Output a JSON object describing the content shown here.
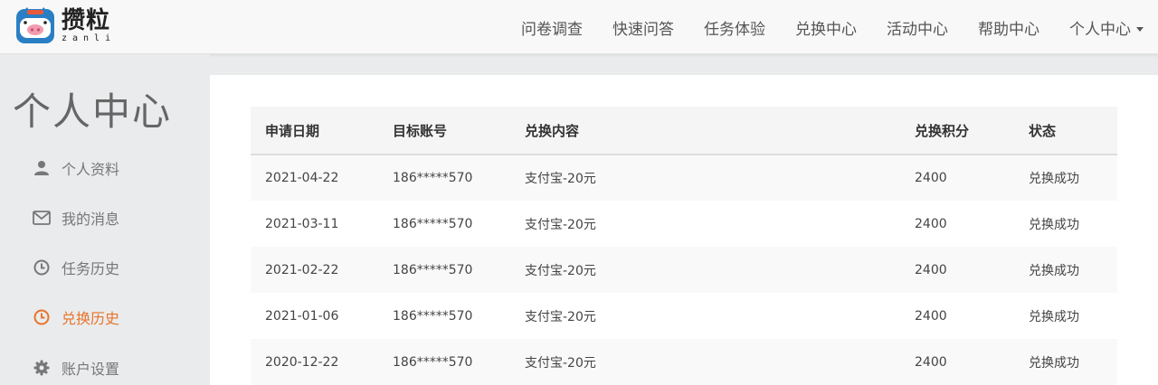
{
  "brand": {
    "name_cn": "攒粒",
    "name_en": "zanli"
  },
  "nav": {
    "items": [
      "问卷调查",
      "快速问答",
      "任务体验",
      "兑换中心",
      "活动中心",
      "帮助中心"
    ],
    "account": "个人中心"
  },
  "sidebar": {
    "title": "个人中心",
    "items": [
      {
        "label": "个人资料",
        "icon": "user-icon"
      },
      {
        "label": "我的消息",
        "icon": "envelope-icon"
      },
      {
        "label": "任务历史",
        "icon": "clock-icon"
      },
      {
        "label": "兑换历史",
        "icon": "clock-icon",
        "active": true
      },
      {
        "label": "账户设置",
        "icon": "gear-icon"
      }
    ]
  },
  "colors": {
    "accent": "#e8742b",
    "logo_blue": "#2a7fc4"
  },
  "table": {
    "headers": [
      "申请日期",
      "目标账号",
      "兑换内容",
      "兑换积分",
      "状态"
    ],
    "rows": [
      [
        "2021-04-22",
        "186*****570",
        "支付宝-20元",
        "2400",
        "兑换成功"
      ],
      [
        "2021-03-11",
        "186*****570",
        "支付宝-20元",
        "2400",
        "兑换成功"
      ],
      [
        "2021-02-22",
        "186*****570",
        "支付宝-20元",
        "2400",
        "兑换成功"
      ],
      [
        "2021-01-06",
        "186*****570",
        "支付宝-20元",
        "2400",
        "兑换成功"
      ],
      [
        "2020-12-22",
        "186*****570",
        "支付宝-20元",
        "2400",
        "兑换成功"
      ]
    ]
  }
}
